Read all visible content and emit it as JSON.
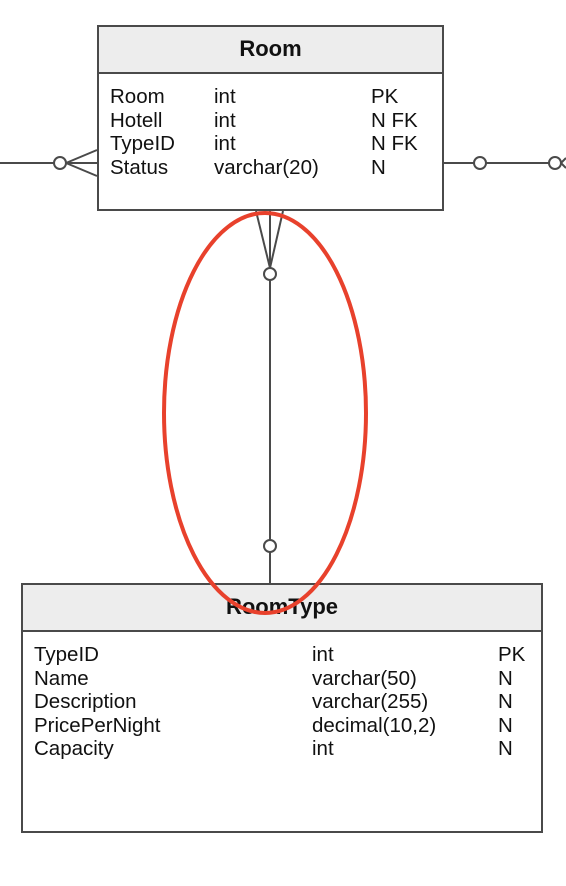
{
  "diagram": {
    "type": "ER diagram (crow's foot notation)",
    "entities": [
      {
        "name": "Room",
        "columns": [
          {
            "name": "Room",
            "type": "int",
            "key": "PK"
          },
          {
            "name": "Hotell",
            "type": "int",
            "key": "N FK"
          },
          {
            "name": "TypeID",
            "type": "int",
            "key": "N FK"
          },
          {
            "name": "Status",
            "type": "varchar(20)",
            "key": "N"
          }
        ]
      },
      {
        "name": "RoomType",
        "columns": [
          {
            "name": "TypeID",
            "type": "int",
            "key": "PK"
          },
          {
            "name": "Name",
            "type": "varchar(50)",
            "key": "N"
          },
          {
            "name": "Description",
            "type": "varchar(255)",
            "key": "N"
          },
          {
            "name": "PricePerNight",
            "type": "decimal(10,2)",
            "key": "N"
          },
          {
            "name": "Capacity",
            "type": "int",
            "key": "N"
          }
        ]
      }
    ],
    "relationships": [
      {
        "from": "Room",
        "to": "RoomType",
        "from_end": "zero-or-many",
        "to_end": "zero-or-one",
        "highlighted": true
      },
      {
        "from": "Room",
        "to": "(offscreen left)",
        "from_end": "zero-or-many",
        "to_end": "unknown"
      },
      {
        "from": "Room",
        "to": "(offscreen right)",
        "from_end": "zero-or-one",
        "to_end": "zero-or-many"
      }
    ],
    "highlight": {
      "shape": "ellipse",
      "color": "#e8412c",
      "target": "Room-RoomType relationship"
    },
    "colors": {
      "line": "#4a4a4a",
      "header_bg": "#ededed",
      "highlight": "#e8412c"
    }
  }
}
